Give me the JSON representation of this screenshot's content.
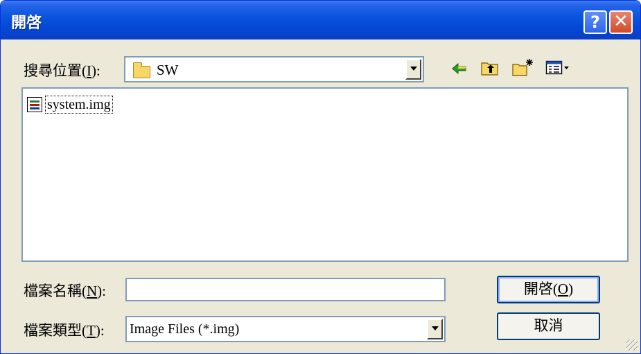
{
  "window": {
    "title": "開啓",
    "help_label": "?",
    "close_label": "✕"
  },
  "look_in": {
    "label": "搜尋位置",
    "hotkey": "I",
    "value": "SW",
    "icon": "folder-icon"
  },
  "toolbar": {
    "icons": [
      "back-arrow-icon",
      "up-one-level-icon",
      "new-folder-icon",
      "view-menu-icon"
    ]
  },
  "files": [
    {
      "name": "system.img",
      "icon": "stacked-file-icon"
    }
  ],
  "file_name": {
    "label": "檔案名稱",
    "hotkey": "N",
    "value": ""
  },
  "file_type": {
    "label": "檔案類型",
    "hotkey": "T",
    "value": "Image Files (*.img)"
  },
  "buttons": {
    "open_label": "開啓",
    "open_hotkey": "O",
    "cancel_label": "取消"
  }
}
